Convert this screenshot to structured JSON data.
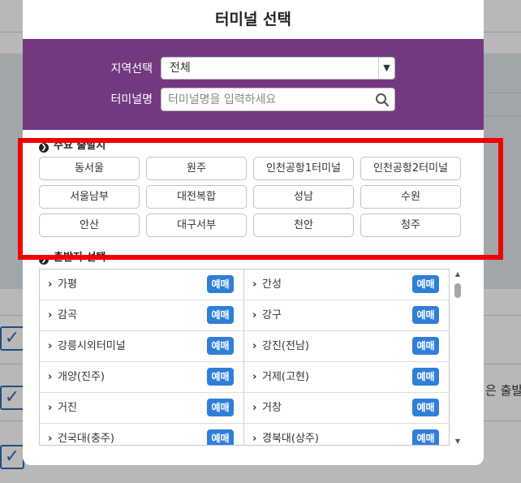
{
  "modal": {
    "title": "터미널 선택"
  },
  "search": {
    "region_label": "지역선택",
    "region_value": "전체",
    "name_label": "터미널명",
    "name_placeholder": "터미널명을 입력하세요"
  },
  "major": {
    "title": "주요 출발지",
    "items": [
      {
        "label": "동서울"
      },
      {
        "label": "원주"
      },
      {
        "label": "인천공항1터미널"
      },
      {
        "label": "인천공항2터미널"
      },
      {
        "label": "서울남부"
      },
      {
        "label": "대전복합"
      },
      {
        "label": "성남"
      },
      {
        "label": "수원"
      },
      {
        "label": "안산"
      },
      {
        "label": "대구서부"
      },
      {
        "label": "천안"
      },
      {
        "label": "청주"
      }
    ]
  },
  "departure": {
    "title": "출발지 선택",
    "reserve_label": "예매",
    "rows": [
      {
        "left": "가평",
        "right": "간성"
      },
      {
        "left": "감곡",
        "right": "강구"
      },
      {
        "left": "강릉시외터미널",
        "right": "강진(전남)"
      },
      {
        "left": "개양(진주)",
        "right": "거제(고현)"
      },
      {
        "left": "거진",
        "right": "거창"
      },
      {
        "left": "건국대(충주)",
        "right": "경북대(상주)"
      }
    ]
  },
  "background": {
    "side_text": "은 출발지"
  },
  "colors": {
    "panel": "#74387f",
    "reserve_button": "#2f7fd8",
    "highlight_frame": "#f20000"
  }
}
